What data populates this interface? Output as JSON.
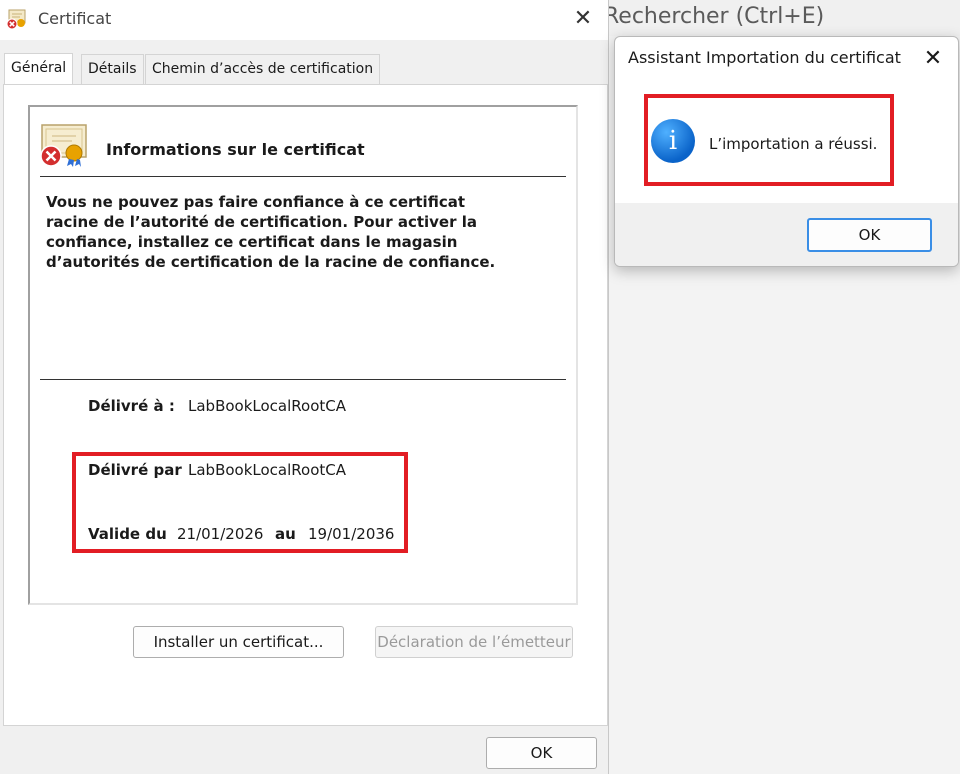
{
  "background": {
    "search_text": "Rechercher (Ctrl+E)"
  },
  "cert_window": {
    "title": "Certificat",
    "close_glyph": "✕",
    "tabs": [
      {
        "label": "Général",
        "active": true
      },
      {
        "label": "Détails",
        "active": false
      },
      {
        "label": "Chemin d’accès de certification",
        "active": false
      }
    ],
    "info_title": "Informations sur le certificat",
    "warning": "Vous ne pouvez pas faire confiance à ce certificat racine de l’autorité de certification. Pour activer la confiance, installez ce certificat dans le magasin d’autorités de certification de la racine de confiance.",
    "issued_to_label": "Délivré à :",
    "issued_to_value": "LabBookLocalRootCA",
    "issued_by_label": "Délivré par",
    "issued_by_value": "LabBookLocalRootCA",
    "valid_from_label": "Valide du",
    "valid_from_value": "21/01/2026",
    "valid_to_label": "au",
    "valid_to_value": "19/01/2036",
    "install_button": "Installer un certificat...",
    "issuer_statement_button": "Déclaration de l’émetteur",
    "ok_button": "OK"
  },
  "wizard": {
    "title": "Assistant Importation du certificat",
    "close_glyph": "✕",
    "message": "L’importation a réussi.",
    "info_glyph": "i",
    "ok_button": "OK"
  },
  "colors": {
    "highlight_red": "#e21d24",
    "info_blue": "#0a63c9",
    "dialog_bg": "#f0f0f0"
  },
  "icons": [
    "certificate-error-icon",
    "close-icon",
    "information-icon"
  ]
}
